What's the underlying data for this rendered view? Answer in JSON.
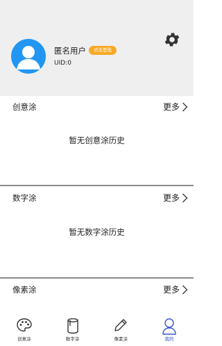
{
  "profile": {
    "username": "匿名用户",
    "login_badge": "点击登陆",
    "uid": "UID:0",
    "avatar_color": "#2196f3",
    "icons": [
      "settings-gear-icon",
      "user-avatar-icon"
    ]
  },
  "sections": [
    {
      "title": "创意涂",
      "more_label": "更多",
      "empty_text": "暂无创意涂历史"
    },
    {
      "title": "数字涂",
      "more_label": "更多",
      "empty_text": "暂无数字涂历史"
    },
    {
      "title": "像素涂",
      "more_label": "更多"
    }
  ],
  "tabs": [
    {
      "label": "创意涂",
      "icon": "palette-icon"
    },
    {
      "label": "数字涂",
      "icon": "paint-bucket-icon"
    },
    {
      "label": "像素涂",
      "icon": "pencil-icon"
    },
    {
      "label": "我的",
      "icon": "profile-icon",
      "active": true
    }
  ],
  "colors": {
    "accent": "#3a56d4",
    "badge": "#f7a928",
    "header_bg": "#efefef"
  }
}
